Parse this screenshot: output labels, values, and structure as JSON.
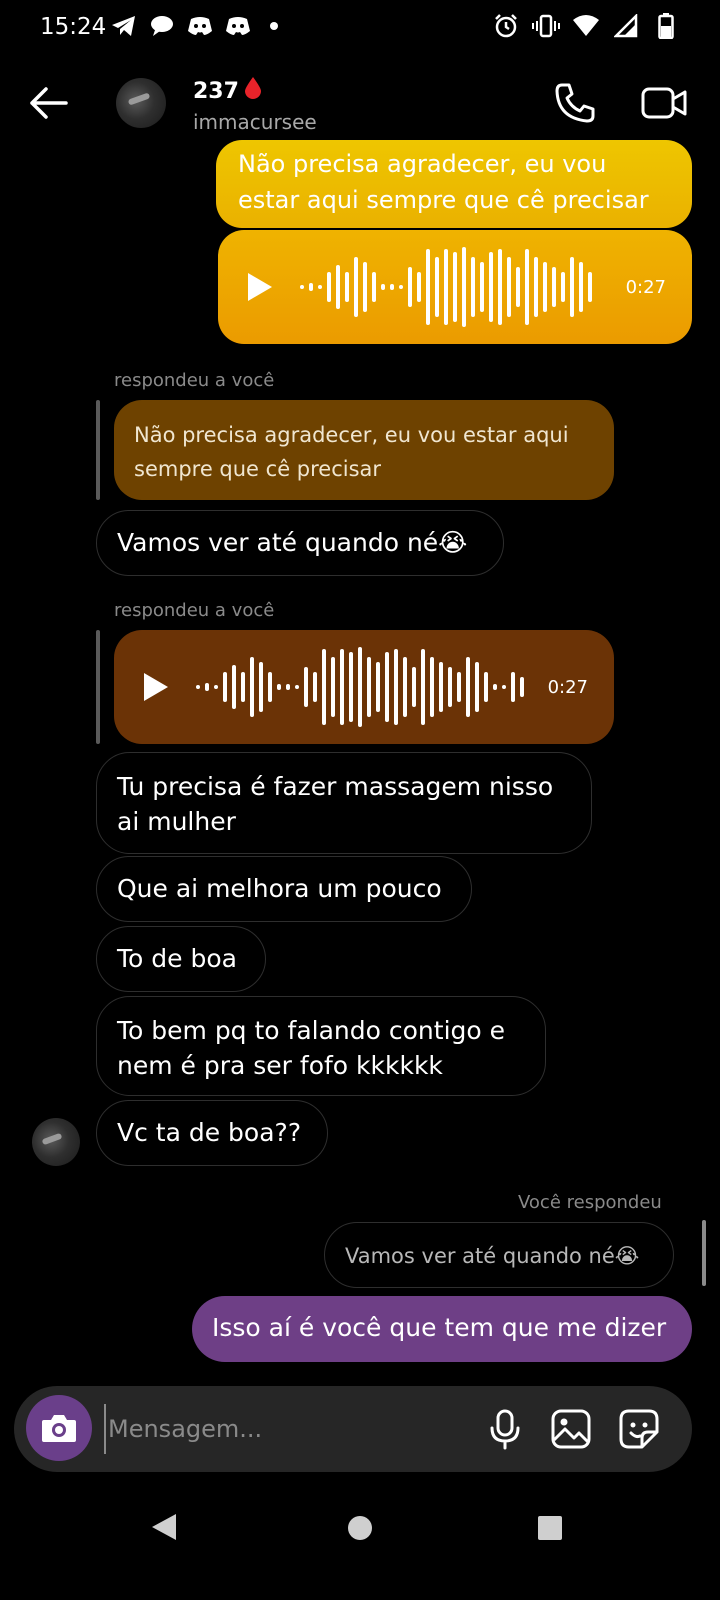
{
  "status_bar": {
    "time": "15:24",
    "left_icons": [
      "telegram-icon",
      "chat-bubble-icon",
      "discord-icon",
      "discord-icon",
      "notification-dot"
    ],
    "right_icons": [
      "alarm-icon",
      "vibrate-icon",
      "wifi-icon",
      "signal-icon",
      "battery-icon"
    ]
  },
  "header": {
    "title": "237",
    "title_emoji": "drop-of-blood-icon",
    "username": "immacursee"
  },
  "messages": {
    "m1": "Não precisa agradecer, eu vou estar aqui sempre que cê precisar",
    "audio1_duration": "0:27",
    "reply_label_1": "respondeu a você",
    "quote1": "Não precisa agradecer, eu vou estar aqui sempre que cê precisar",
    "m2": "Vamos ver até quando né😭",
    "reply_label_2": "respondeu a você",
    "audio2_duration": "0:27",
    "m3": "Tu precisa é fazer massagem nisso ai mulher",
    "m4": "Que ai melhora um pouco",
    "m5": "To de boa",
    "m6": "To bem pq to falando contigo e nem é pra ser fofo kkkkkk",
    "m7": "Vc ta de boa??",
    "reply_label_3": "Você respondeu",
    "quote2": "Vamos ver até quando né😭",
    "m8": "Isso aí é você que tem que me dizer"
  },
  "composer": {
    "placeholder": "Mensagem..."
  },
  "colors": {
    "outgoing_top": "#eec600",
    "outgoing_bottom": "#eb9b00",
    "quote_brown": "#6e4200",
    "quote_rust": "#6b3306",
    "purple": "#6e3f86",
    "camera_button": "#6a3f8a"
  }
}
